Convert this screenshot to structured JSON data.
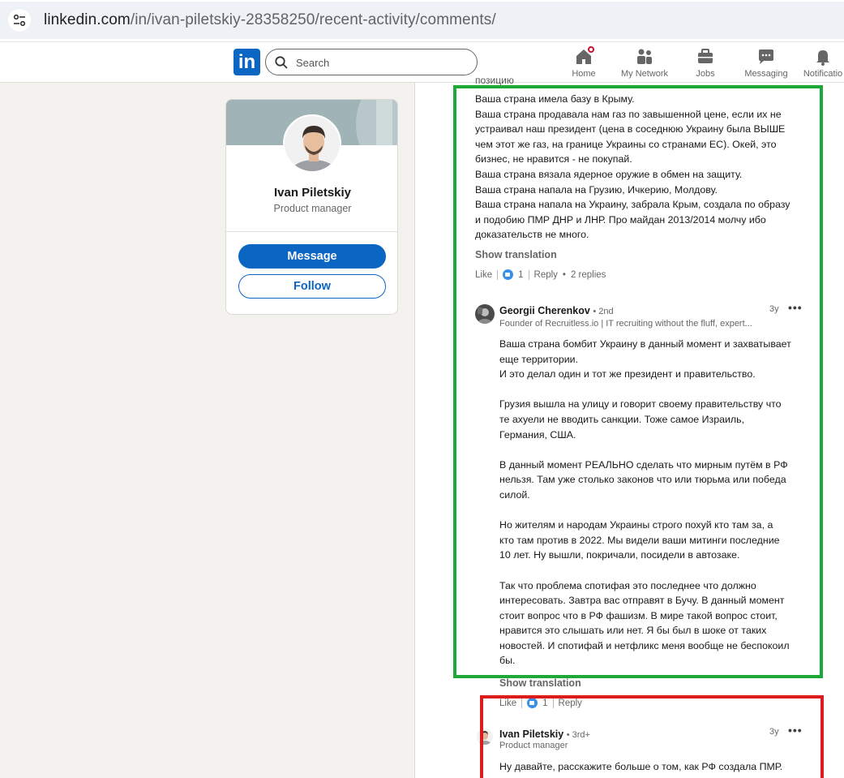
{
  "browser": {
    "url_host": "linkedin.com",
    "url_path": "/in/ivan-piletskiy-28358250/recent-activity/comments/"
  },
  "nav": {
    "search_placeholder": "Search",
    "items": [
      {
        "label": "Home",
        "icon": "home-icon"
      },
      {
        "label": "My Network",
        "icon": "network-icon"
      },
      {
        "label": "Jobs",
        "icon": "jobs-icon"
      },
      {
        "label": "Messaging",
        "icon": "messaging-icon"
      },
      {
        "label": "Notificatio",
        "icon": "bell-icon"
      }
    ]
  },
  "profile": {
    "name": "Ivan Piletskiy",
    "headline": "Product manager",
    "message_label": "Message",
    "follow_label": "Follow"
  },
  "comments": {
    "first": {
      "cut_top": "позицию",
      "lines": [
        "Ваша страна имела базу в Крыму.",
        "Ваша страна продавала нам газ по завышенной цене, если их не",
        "устраивал наш президент (цена в соседнюю Украину была ВЫШЕ",
        "чем этот же газ, на границе Украины со странами ЕС). Окей, это",
        "бизнес, не нравится - не покупай.",
        "Ваша страна вязала ядерное оружие в обмен на защиту.",
        "Ваша страна напала на Грузию, Ичкерию, Молдову.",
        "Ваша страна напала на Украину, забрала Крым, создала по образу",
        "и подобию ПМР ДНР и ЛНР. Про майдан 2013/2014 молчу ибо",
        "доказательств не много."
      ],
      "show_translation": "Show translation",
      "like": "Like",
      "like_count": "1",
      "reply": "Reply",
      "replies": "2 replies"
    },
    "second": {
      "author": "Georgii Cherenkov",
      "degree": "• 2nd",
      "headline": "Founder of Recruitless.io | IT recruiting without the fluff, expert...",
      "time": "3y",
      "more": "•••",
      "lines": [
        "Ваша страна бомбит Украину в данный момент и захватывает",
        "еще территории.",
        "И это делал один и тот же президент и правительство.",
        "",
        "Грузия вышла на улицу и говорит своему правительству что",
        "те ахуели не вводить санкции. Тоже самое Израиль,",
        "Германия, США.",
        "",
        "В данный момент РЕАЛЬНО сделать что мирным путём в РФ",
        "нельзя. Там уже столько законов что или тюрьма или победа",
        "силой.",
        "",
        "Но жителям и народам Украины строго похуй кто там за, а",
        "кто там против в 2022. Мы видели ваши митинги последние",
        "10 лет. Ну вышли, покричали, посидели в автозаке.",
        "",
        "Так что проблема спотифая это последнее что должно",
        "интересовать. Завтра вас отправят в Бучу. В данный момент",
        "стоит вопрос что в РФ фашизм. В мире такой вопрос стоит,",
        "нравится это слышать или нет. Я бы был в шоке от таких",
        "новостей. И спотифай и нетфликс меня вообще не беспокоил",
        "бы."
      ],
      "show_translation": "Show translation",
      "like": "Like",
      "like_count": "1",
      "reply": "Reply"
    },
    "third": {
      "author": "Ivan Piletskiy",
      "degree": "• 3rd+",
      "headline": "Product manager",
      "time": "3y",
      "more": "•••",
      "text": "Ну давайте, расскажите больше о том, как РФ создала ПМР."
    }
  },
  "colors": {
    "brand": "#0a66c2",
    "highlight_green": "#1ea838",
    "highlight_red": "#dc1c1c"
  }
}
